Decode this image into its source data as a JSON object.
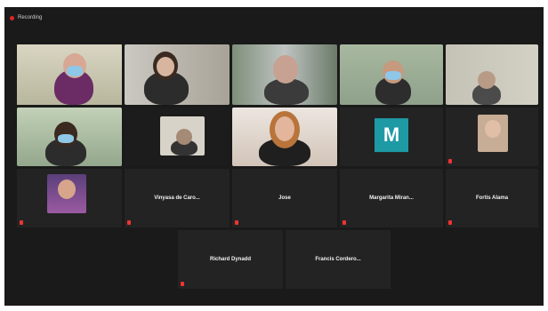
{
  "app": {
    "recording_label": "Recording"
  },
  "tiles": [
    {
      "name": ""
    },
    {
      "name": ""
    },
    {
      "name": ""
    },
    {
      "name": ""
    },
    {
      "name": ""
    },
    {
      "name": ""
    },
    {
      "name": ""
    },
    {
      "name": ""
    },
    {
      "name": ""
    },
    {
      "name": ""
    },
    {
      "name": ""
    },
    {
      "name": "Vinyasa de Caro..."
    },
    {
      "name": "Jose"
    },
    {
      "name": "Margarita Miran..."
    },
    {
      "name": "Fortis Alama"
    },
    {
      "name": "Richard Dynadd"
    },
    {
      "name": "Francis Cordero..."
    }
  ],
  "avatar_letter": "M",
  "colors": {
    "active_border": "#b7c35a",
    "recording": "#e02424",
    "avatar_bg": "#1e9aa5"
  }
}
